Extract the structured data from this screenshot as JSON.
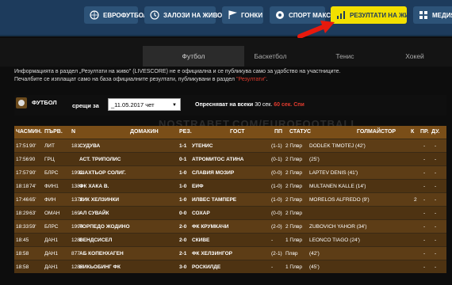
{
  "nav": {
    "items": [
      {
        "label": "ЕВРОФУТБОЛ",
        "icon": "eurofootball-logo-icon"
      },
      {
        "label": "ЗАЛОЗИ НА ЖИВО",
        "icon": "clock-icon"
      },
      {
        "label": "ГОНКИ",
        "icon": "racing-flag-icon"
      },
      {
        "label": "СПОРТ МАКС",
        "icon": "ball-icon"
      },
      {
        "label": "РЕЗУЛТАТИ НА ЖИВО",
        "icon": "bar-chart-icon"
      },
      {
        "label": "МЕДИЯ",
        "icon": "grid-icon"
      }
    ],
    "active_color": "#f2e000"
  },
  "sports_tabs": [
    "Футбол",
    "Баскетбол",
    "Тенис",
    "Хокей"
  ],
  "info": {
    "line1": "Информацията в раздел „Резултати на живо\" (LIVESCORE) не е официална и се публикува само за удобство на участниците.",
    "line2_prefix": "Печалбите се изплащат само на база официалните резултати, публикувани в раздел ",
    "line2_link": "\"Резултати\"",
    "line2_suffix": "."
  },
  "section": {
    "title": "ФУТБОЛ",
    "date_label": "срещи за",
    "date_value": "_11.05.2017 чет",
    "refresh_prefix": "Опресняват на всеки",
    "refresh_seconds": "30 сек.",
    "refresh_alt": "60 сек.",
    "refresh_stop": "Спи"
  },
  "watermark": "NOSTRABET.COM/EUROFOOTBALL",
  "table": {
    "headers": {
      "time": "ЧАС",
      "minute": "МИН.",
      "league": "ПЪРВ.",
      "num": "N",
      "home": "ДОМАКИН",
      "score": "РЕЗ.",
      "away": "ГОСТ",
      "ht": "ПП",
      "status": "СТАТУС",
      "scorer": "ГОЛМАЙСТОР",
      "k": "К",
      "pr": "ПР.",
      "du": "ДУ."
    },
    "rows": [
      {
        "time": "17:51",
        "min": "90'",
        "league": "ЛИТ",
        "num": "181",
        "home": "СУДУВА",
        "score": "1-1",
        "away": "УТЕНИС",
        "ht": "(1-1)",
        "status": "2 Плвр",
        "scorer": "DODLEK TIMOTEJ (42')",
        "k": "",
        "pr": "-",
        "du": "-"
      },
      {
        "time": "17:56",
        "min": "90",
        "league": "ГРЦ",
        "num": "",
        "home": "АСТ. ТРИПОЛИС",
        "score": "0-1",
        "away": "АТРОМИТОС АТИНА",
        "ht": "(0-1)",
        "status": "2 Плвр",
        "scorer": "(25')",
        "k": "",
        "pr": "-",
        "du": "-"
      },
      {
        "time": "17:57",
        "min": "90'",
        "league": "БЛРС",
        "num": "1992",
        "home": "ШАХТЬОР СОЛИГ.",
        "score": "1-0",
        "away": "СЛАВИЯ МОЗИР",
        "ht": "(0-0)",
        "status": "2 Плвр",
        "scorer": "LAPTEV DENIS (41')",
        "k": "",
        "pr": "-",
        "du": "-"
      },
      {
        "time": "18:18",
        "min": "74'",
        "league": "ФИН1",
        "num": "1383",
        "home": "ФК ХАКА В.",
        "score": "1-0",
        "away": "ЕИФ",
        "ht": "(1-0)",
        "status": "2 Плвр",
        "scorer": "MULTANEN KALLE (14')",
        "k": "",
        "pr": "-",
        "du": "-"
      },
      {
        "time": "17:46",
        "min": "65'",
        "league": "ФИН",
        "num": "1372",
        "home": "ХИК ХЕЛЗИНКИ",
        "score": "1-0",
        "away": "ИЛВЕС ТАМПЕРЕ",
        "ht": "(1-0)",
        "status": "2 Плвр",
        "scorer": "MORELOS ALFREDO (9')",
        "k": "2",
        "pr": "-",
        "du": "-"
      },
      {
        "time": "18:29",
        "min": "63'",
        "league": "ОМАН",
        "num": "169",
        "home": "АЛ СУВАЙК",
        "score": "0-0",
        "away": "СОХАР",
        "ht": "(0-0)",
        "status": "2 Плвр",
        "scorer": "",
        "k": "",
        "pr": "-",
        "du": "-"
      },
      {
        "time": "18:33",
        "min": "59'",
        "league": "БЛРС",
        "num": "1994",
        "home": "ТОРПЕДО ЖОДИНО",
        "score": "2-0",
        "away": "ФК КРУМКАЧИ",
        "ht": "(2-0)",
        "status": "2 Плвр",
        "scorer": "ZUBOVICH YAHOR (34')",
        "k": "",
        "pr": "-",
        "du": "-"
      },
      {
        "time": "18:45",
        "min": "",
        "league": "ДАН1",
        "num": "1280",
        "home": "ВЕНДСИСЕЛ",
        "score": "2-0",
        "away": "СКИВЕ",
        "ht": "-",
        "status": "1 Плвр",
        "scorer": "LEONCO TIAGO (24')",
        "k": "",
        "pr": "-",
        "du": "-"
      },
      {
        "time": "18:58",
        "min": "",
        "league": "ДАН1",
        "num": "877",
        "home": "АБ КОПЕНХАГЕН",
        "score": "2-1",
        "away": "ФК ХЕЛЗИНГОР",
        "ht": "(2-1)",
        "status": "Плвр",
        "scorer": "(42')",
        "k": "",
        "pr": "-",
        "du": "-"
      },
      {
        "time": "18:58",
        "min": "",
        "league": "ДАН1",
        "num": "1282",
        "home": "НИКЬОБИНГ ФК",
        "score": "3-0",
        "away": "РОСКИЛДЕ",
        "ht": "-",
        "status": "1 Плвр",
        "scorer": "(45')",
        "k": "",
        "pr": "-",
        "du": "-"
      }
    ]
  }
}
